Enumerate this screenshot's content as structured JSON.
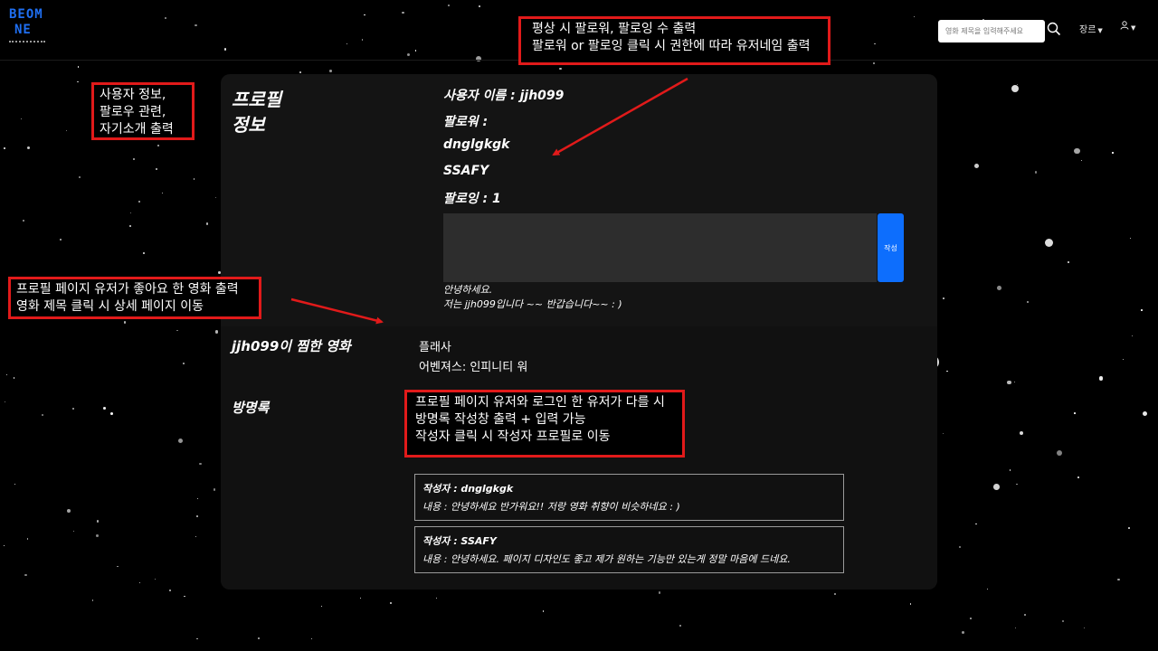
{
  "navbar": {
    "logo_line1": "BEOM",
    "logo_line2": "NE",
    "search_placeholder": "영화 제목을 입력해주세요",
    "genre_label": "장르",
    "user_icon": "person-icon",
    "search_icon": "magnifier-icon"
  },
  "profile": {
    "heading_line1": "프로필",
    "heading_line2": "정보",
    "username": "사용자 이름 : jjh099",
    "followers_label": "팔로워 :",
    "followers": [
      "dnglgkgk",
      "SSAFY"
    ],
    "following": "팔로잉 : 1",
    "submit_label": "작성",
    "intro_line1": "안녕하세요.",
    "intro_line2": "저는 jjh099입니다 ~~ 반갑습니다~~ : )"
  },
  "liked": {
    "heading": "jjh099이 찜한 영화",
    "movies": [
      "플래사",
      "어벤져스: 인피니티 워"
    ]
  },
  "guestbook": {
    "heading": "방명록",
    "entries": [
      {
        "author": "작성자 : dnglgkgk",
        "content": "내용 : 안녕하세요 반가워요!! 저랑 영화 취향이 비슷하네요 : )"
      },
      {
        "author": "작성자 : SSAFY",
        "content": "내용 : 안녕하세요. 페이지 디자인도 좋고 제가 원하는 기능만 있는게 정말 마음에 드네요."
      }
    ]
  },
  "annotations": {
    "follow": [
      "평상 시 팔로워, 팔로잉 수 출력",
      "팔로워 or 팔로잉 클릭 시 권한에 따라 유저네임 출력"
    ],
    "user_info": [
      "사용자 정보,",
      "팔로우 관련,",
      "자기소개 출력"
    ],
    "liked_movies": [
      "프로필 페이지 유저가 좋아요 한 영화 출력",
      "영화 제목 클릭 시 상세 페이지 이동"
    ],
    "guestbook": [
      "프로필 페이지 유저와 로그인 한 유저가 다를 시",
      "방명록 작성창 출력 + 입력 가능",
      "작성자 클릭 시 작성자 프로필로 이동"
    ]
  },
  "colors": {
    "background": "#000000",
    "panel": "#141414",
    "accent_blue": "#0d6efd",
    "annotation_red": "#e11a1a"
  }
}
